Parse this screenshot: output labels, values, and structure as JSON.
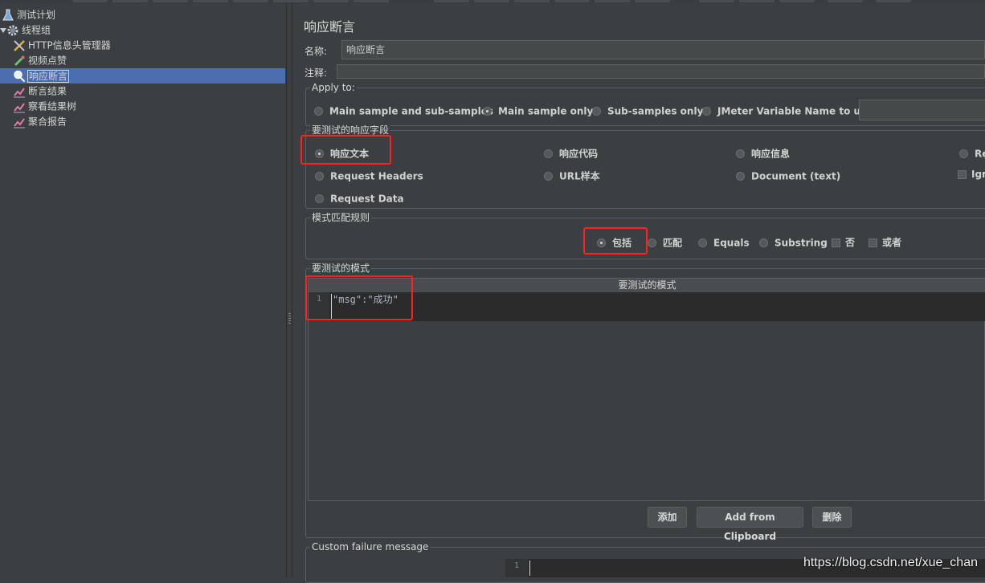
{
  "tree": {
    "items": [
      {
        "label": "测试计划",
        "icon": "flask-icon"
      },
      {
        "label": "线程组",
        "icon": "gear-icon"
      },
      {
        "label": "HTTP信息头管理器",
        "icon": "tools-icon"
      },
      {
        "label": "视频点赞",
        "icon": "pipette-icon"
      },
      {
        "label": "响应断言",
        "icon": "magnifier-icon",
        "selected": true
      },
      {
        "label": "断言结果",
        "icon": "chart-icon"
      },
      {
        "label": "察看结果树",
        "icon": "chart-icon"
      },
      {
        "label": "聚合报告",
        "icon": "chart-icon"
      }
    ]
  },
  "panel": {
    "title": "响应断言",
    "name_label": "名称:",
    "name_value": "响应断言",
    "comment_label": "注释:",
    "comment_value": ""
  },
  "apply_to": {
    "title": "Apply to:",
    "options": [
      "Main sample and sub-samples",
      "Main sample only",
      "Sub-samples only",
      "JMeter Variable Name to use"
    ],
    "selected": "Main sample only",
    "variable_value": ""
  },
  "fields": {
    "title": "要测试的响应字段",
    "options": [
      "响应文本",
      "响应代码",
      "响应信息",
      "Re",
      "Request Headers",
      "URL样本",
      "Document (text)",
      "Request Data"
    ],
    "selected": "响应文本",
    "ignore_label": "Igr"
  },
  "rules": {
    "title": "模式匹配规则",
    "options": [
      "包括",
      "匹配",
      "Equals",
      "Substring"
    ],
    "selected": "包括",
    "not_label": "否",
    "or_label": "或者"
  },
  "patterns": {
    "title": "要测试的模式",
    "column_header": "要测试的模式",
    "line_number": "1",
    "value": "\"msg\":\"成功\"",
    "add_label": "添加",
    "clipboard_label": "Add from Clipboard",
    "delete_label": "删除"
  },
  "failure": {
    "title": "Custom failure message",
    "line_number": "1",
    "value": ""
  },
  "watermark": "https://blog.csdn.net/xue_chan",
  "colors": {
    "background": "#3c3f41",
    "selection": "#4b6eaf",
    "highlight": "#ff2020",
    "editor": "#2b2b2b"
  }
}
